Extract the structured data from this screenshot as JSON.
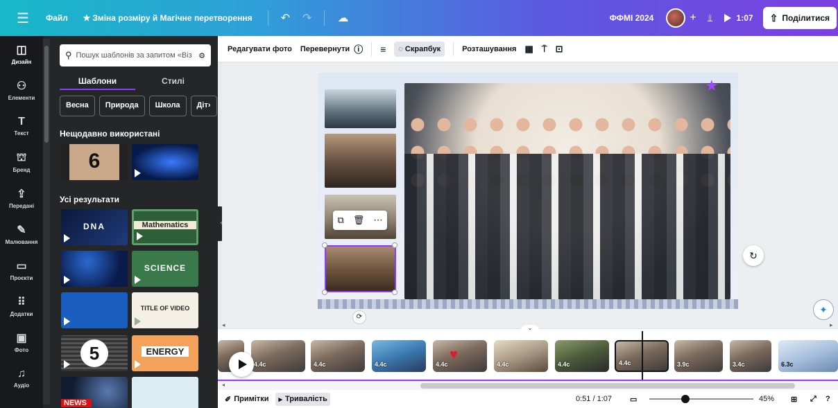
{
  "topbar": {
    "file_label": "Файл",
    "resize_label": "Зміна розміру й Магічне перетворення",
    "project_name": "ФФМІ 2024",
    "play_time": "1:07",
    "share_label": "Поділитися"
  },
  "rail": {
    "items": [
      {
        "label": "Дизайн",
        "icon": "layout-icon"
      },
      {
        "label": "Елементи",
        "icon": "shapes-icon"
      },
      {
        "label": "Текст",
        "icon": "text-icon"
      },
      {
        "label": "Бренд",
        "icon": "brand-icon"
      },
      {
        "label": "Передані",
        "icon": "upload-icon"
      },
      {
        "label": "Малювання",
        "icon": "draw-icon"
      },
      {
        "label": "Проєкти",
        "icon": "folder-icon"
      },
      {
        "label": "Додатки",
        "icon": "apps-icon"
      },
      {
        "label": "Фото",
        "icon": "photo-icon"
      },
      {
        "label": "Аудіо",
        "icon": "audio-icon"
      }
    ]
  },
  "panel": {
    "search_placeholder": "Пошук шаблонів за запитом «Віз",
    "tabs": [
      "Шаблони",
      "Стилі"
    ],
    "chips": [
      "Весна",
      "Природа",
      "Школа",
      "Діт"
    ],
    "recent_title": "Нещодавно використані",
    "all_title": "Усі результати",
    "templates": [
      {
        "label": "DNA"
      },
      {
        "label": "Mathematics"
      },
      {
        "label": ""
      },
      {
        "label": "SCIENCE"
      },
      {
        "label": ""
      },
      {
        "label": "TITLE OF VIDEO"
      },
      {
        "label": "5"
      },
      {
        "label": "ENERGY"
      },
      {
        "label": "NEWS"
      },
      {
        "label": ""
      }
    ],
    "recent": [
      {
        "label": "6"
      },
      {
        "label": ""
      }
    ]
  },
  "toolbar": {
    "edit_photo": "Редагувати фото",
    "flip": "Перевернути",
    "scrapbook": "Скрапбук",
    "position": "Розташування"
  },
  "timeline": {
    "clips": [
      {
        "duration": ""
      },
      {
        "duration": "4.4c"
      },
      {
        "duration": "4.4c"
      },
      {
        "duration": "4.4c"
      },
      {
        "duration": "4.4c"
      },
      {
        "duration": "4.4c"
      },
      {
        "duration": "4.4c"
      },
      {
        "duration": "4.4c"
      },
      {
        "duration": "3.9c"
      },
      {
        "duration": "3.4c"
      },
      {
        "duration": "6.3c"
      }
    ],
    "active_index": 7
  },
  "bottombar": {
    "notes_label": "Примітки",
    "duration_label": "Тривалість",
    "time": "0:51 / 1:07",
    "zoom": "45%"
  },
  "colors": {
    "accent": "#8b3dff",
    "topbar_start": "#18b8c8",
    "topbar_end": "#7b3fe0",
    "panel_bg": "#252627"
  }
}
